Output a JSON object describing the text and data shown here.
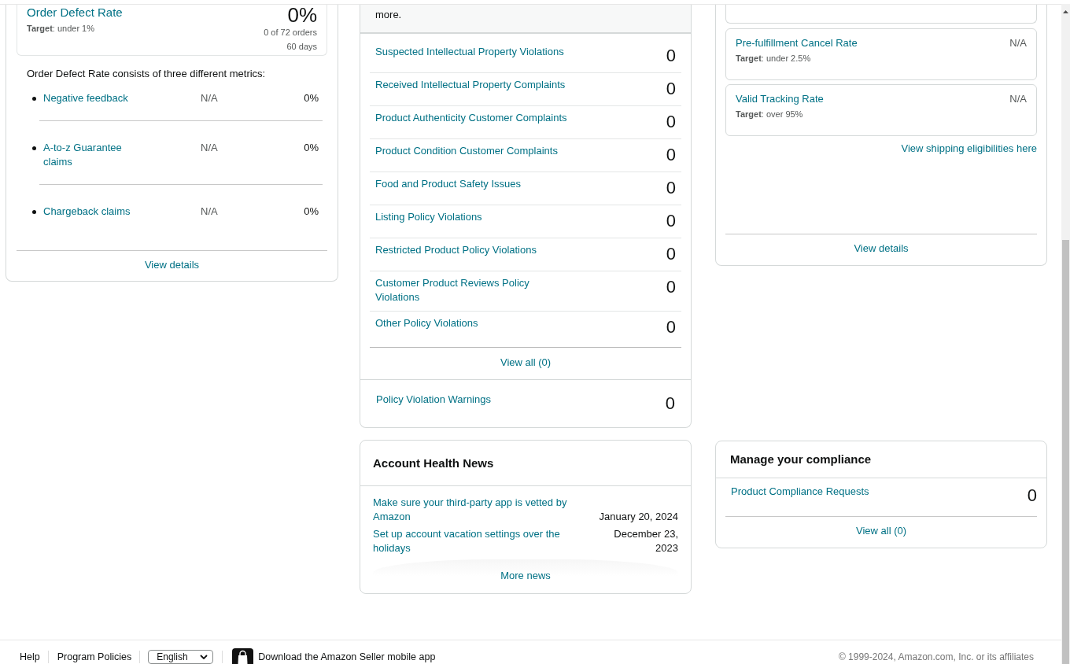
{
  "order_defect": {
    "title": "Order Defect Rate",
    "value": "0%",
    "target": "**Target**: under 1%",
    "orders": "0 of 72 orders",
    "period": "60 days",
    "intro": "Order Defect Rate consists of three different metrics:",
    "metrics": [
      {
        "name": "Negative feedback",
        "status": "N/A",
        "value": "0%"
      },
      {
        "name": "A-to-z Guarantee claims",
        "status": "N/A",
        "value": "0%"
      },
      {
        "name": "Chargeback claims",
        "status": "N/A",
        "value": "0%"
      }
    ],
    "details_link": "View details"
  },
  "policy_compliance": {
    "intro_tail": "more.",
    "violations": [
      {
        "name": "Suspected Intellectual Property Violations",
        "count": "0"
      },
      {
        "name": "Received Intellectual Property Complaints",
        "count": "0"
      },
      {
        "name": "Product Authenticity Customer Complaints",
        "count": "0"
      },
      {
        "name": "Product Condition Customer Complaints",
        "count": "0"
      },
      {
        "name": "Food and Product Safety Issues",
        "count": "0"
      },
      {
        "name": "Listing Policy Violations",
        "count": "0"
      },
      {
        "name": "Restricted Product Policy Violations",
        "count": "0"
      },
      {
        "name": "Customer Product Reviews Policy Violations",
        "count": "0"
      },
      {
        "name": "Other Policy Violations",
        "count": "0"
      }
    ],
    "view_all": "View all (0)",
    "warnings": {
      "name": "Policy Violation Warnings",
      "count": "0"
    }
  },
  "shipping_performance": {
    "metrics": [
      {
        "name": "Pre-fulfillment Cancel Rate",
        "status": "N/A",
        "target": "**Target**: under 2.5%"
      },
      {
        "name": "Valid Tracking Rate",
        "status": "N/A",
        "target": "**Target**: over 95%"
      }
    ],
    "eligibility_link": "View shipping eligibilities here",
    "details_link": "View details"
  },
  "news": {
    "title": "Account Health News",
    "items": [
      {
        "headline": "Make sure your third-party app is vetted by Amazon",
        "date": "January 20, 2024"
      },
      {
        "headline": "Set up account vacation settings over the holidays",
        "date": "December 23, 2023"
      }
    ],
    "more_link": "More news"
  },
  "compliance": {
    "title": "Manage your compliance",
    "items": [
      {
        "name": "Product Compliance Requests",
        "count": "0"
      }
    ],
    "view_all": "View all (0)"
  },
  "footer": {
    "links": [
      "Help",
      "Program Policies"
    ],
    "language": "English",
    "app_link": "Download the Amazon Seller mobile app",
    "copyright": "© 1999-2024, Amazon.com, Inc. or its affiliates"
  }
}
